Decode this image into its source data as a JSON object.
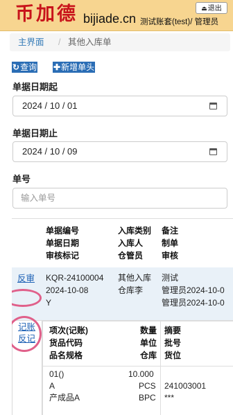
{
  "header": {
    "logo_text": "币加德",
    "domain": "bijiade.cn",
    "user_info": "测试账套(test)/ 管理员",
    "logout_label": "退出"
  },
  "breadcrumb": {
    "home": "主界面",
    "separator": "/",
    "current": "其他入库单"
  },
  "toolbar": {
    "query_label": "查询",
    "add_label": "新增单头"
  },
  "form": {
    "start_date_label": "单据日期起",
    "start_date_value": "2024 / 10 / 01",
    "end_date_label": "单据日期止",
    "end_date_value": "2024 / 10 / 09",
    "doc_no_label": "单号",
    "doc_no_placeholder": "输入单号"
  },
  "table": {
    "headers": [
      [
        "单据编号",
        "入库类别",
        "备注"
      ],
      [
        "单据日期",
        "入库人",
        "制单"
      ],
      [
        "审核标记",
        "仓管员",
        "审核"
      ]
    ],
    "rows": [
      {
        "action": "反审",
        "doc_no": "KQR-24100004",
        "doc_date": "2024-10-08",
        "audit_flag": "Y",
        "category": "其他入库",
        "stocker": "仓库李",
        "remark": "测试",
        "creator": "管理员2024-10-0",
        "auditor": "管理员2024-10-0"
      }
    ]
  },
  "detail": {
    "actions": [
      "记账",
      "反记"
    ],
    "headers": [
      [
        "项次(记账)",
        "数量",
        "摘要"
      ],
      [
        "货品代码",
        "单位",
        "批号"
      ],
      [
        "品名规格",
        "仓库",
        "货位"
      ]
    ],
    "rows": [
      {
        "item_no": "01()",
        "product_code": "A",
        "product_name": "产成品A",
        "quantity": "10.000",
        "unit": "PCS",
        "warehouse": "BPC",
        "summary": "",
        "batch_no": "241003001",
        "location": "***"
      }
    ]
  },
  "colors": {
    "header_bg": "#f7d590",
    "logo_red": "#c8141b",
    "button_blue": "#2a6db5",
    "link_blue": "#1a5fb4",
    "highlight_row": "#e9f1f8",
    "annotation_pink": "#e0608a"
  }
}
